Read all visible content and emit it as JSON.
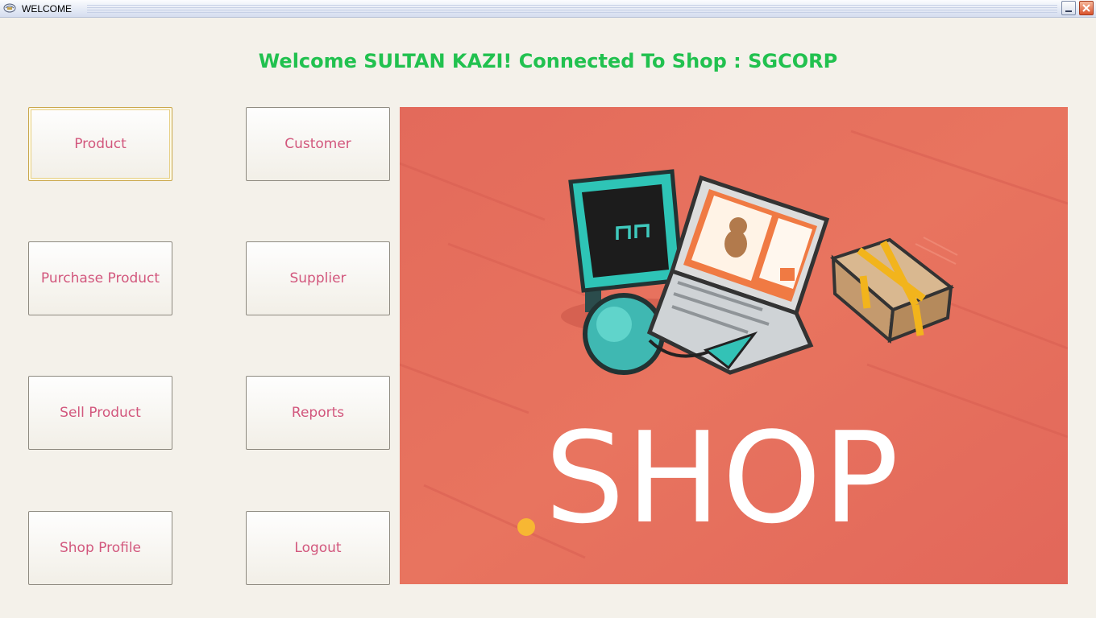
{
  "window": {
    "title": "WELCOME"
  },
  "welcome": {
    "text": "Welcome SULTAN KAZI! Connected To Shop : SGCORP",
    "color": "#21c14f"
  },
  "buttons": {
    "product": "Product",
    "customer": "Customer",
    "purchase_product": "Purchase Product",
    "supplier": "Supplier",
    "sell_product": "Sell Product",
    "reports": "Reports",
    "shop_profile": "Shop Profile",
    "logout": "Logout"
  },
  "banner": {
    "text": "SHOP",
    "background": "#e8705e",
    "accent": "#f7b733"
  },
  "colors": {
    "button_text": "#d2577d",
    "window_bg": "#f4f1ea"
  },
  "icons": [
    "app-icon",
    "minimize-icon",
    "close-icon",
    "robot-monitor-icon",
    "laptop-icon",
    "gift-box-icon"
  ]
}
